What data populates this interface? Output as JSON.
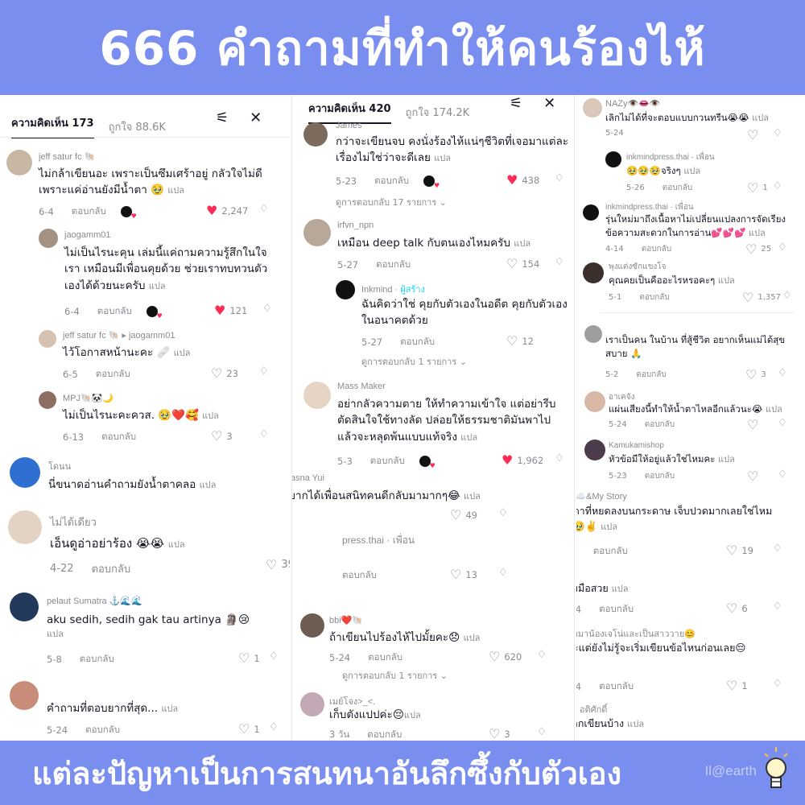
{
  "header": {
    "title": "666 คำถามที่ทำให้คนร้องไห้"
  },
  "footer": {
    "caption": "แต่ละปัญหาเป็นการสนทนาอันลึกซึ้งกับตัวเอง",
    "watermark": "Il@earth"
  },
  "common": {
    "reply": "ตอบกลับ",
    "translate": "แปล"
  },
  "left": {
    "tab_comments": "ความคิดเห็น 173",
    "tab_likes": "ถูกใจ 88.6K",
    "comments": [
      {
        "name": "jeff satur fc 🐚",
        "text": "ไม่กล้าเขียนอะ เพราะเป็นซึมเศร้าอยู่ กลัวใจไม่ดี",
        "text2": "เพราะแค่อ่านยังมีน้ำตา 🥹 ",
        "date": "6-4",
        "likes": "2,247"
      },
      {
        "name": "jaogamm01",
        "text": "ไม่เป็นไรนะคุน เล่มนี้แค่ถามความรู้สึกในใจ",
        "text2": "เรา เหมือนมีเพื่อนคุยด้วย ช่วยเราทบทวนตัว",
        "text3": "เองได้ด้วยนะครับ ",
        "date": "6-4",
        "likes": "121"
      },
      {
        "name": "jeff satur fc 🐚 ▸ jaogamm01",
        "text": "ไว้โอกาสหน้านะคะ 🩹 ",
        "date": "6-5",
        "likes": "23"
      },
      {
        "name": "MPJ🐚🐼🌙",
        "text": "ไม่เป็นไรนะคะควส. 🥹❤️🥰 ",
        "date": "6-13",
        "likes": "3"
      },
      {
        "name": "โดนน",
        "text": "นี่ขนาดอ่านคำถามยังน้ำตาคลอ "
      },
      {
        "name": "ไม่ได้เดียว",
        "text": "เอ็นดูอ่าอย่าร้อง 😭😭 ",
        "date": "4-22",
        "likes": "39"
      },
      {
        "name": "pelaut Sumatra ⚓🌊🌊",
        "text": "aku sedih, sedih gak tau artinya 🗿😢",
        "date": "5-8",
        "likes": "1"
      },
      {
        "name": "",
        "text": "คำถามที่ตอบยากที่สุด... ",
        "date": "5-24",
        "likes": "1"
      }
    ]
  },
  "mid": {
    "tab_comments": "ความคิดเห็น 420",
    "tab_likes": "ถูกใจ 174.2K",
    "comments": [
      {
        "name": "James",
        "text": "กว่าจะเขียนจบ คงนั่งร้องไห้แน่ๆชีวิตที่เจอมาแต่ละ",
        "text2": "เรื่องไม่ใช่ว่าจะดีเลย ",
        "date": "5-23",
        "likes": "438",
        "more": "ดูการตอบกลับ 17 รายการ ⌄"
      },
      {
        "name": "irfvn_npn",
        "text": "เหมือน deep talk กับตนเองไหมครับ ",
        "date": "5-27",
        "likes": "154"
      },
      {
        "name": "Inkmind",
        "badge": "· ผู้สร้าง",
        "text": "ฉันคิดว่าใช่ คุยกับตัวเองในอดีต คุยกับตัวเอง",
        "text2": "ในอนาคตด้วย",
        "date": "5-27",
        "likes": "12",
        "more": "ดูการตอบกลับ 1 รายการ ⌄"
      },
      {
        "name": "Mass Maker",
        "text": "อย่ากลัวความตาย ให้ทำความเข้าใจ แต่อย่ารีบ",
        "text2": "ตัดสินใจใช้ทางลัด ปล่อยให้ธรรมชาติมันพาไป",
        "text3": "แล้วจะหลุดพ้นแบบแท้จริง ",
        "date": "5-3",
        "likes": "1,962"
      },
      {
        "name": "Wasna Yui",
        "text": "อยากได้เพื่อนสนิทคนดีกลับมามากๆ😂 ",
        "likes": "49"
      },
      {
        "name": "press.thai · เพื่อน",
        "likes": "13"
      },
      {
        "name": "bbi❤️🐚",
        "text": "ถ้าเขียนไปร้องไห้ไปมั้ยคะ😞 ",
        "date": "5-24",
        "likes": "620",
        "more": "ดูการตอบกลับ 1 รายการ ⌄"
      },
      {
        "name": "เมย์โจง>_<.",
        "text": "เก็บตังแปปค่ะ😔",
        "date": "3 วัน",
        "likes": "3"
      }
    ]
  },
  "right": {
    "comments": [
      {
        "name": "NAZy👁️👄👁️",
        "text": "เลิกไม่ได้ที่จะตอบแบบกวนทรีน😭😭 ",
        "date": "5-24"
      },
      {
        "name": "inkmindpress.thai · เพื่อน",
        "text": "🥹🥹🥹จริงๆ ",
        "date": "5-26",
        "likes": "1"
      },
      {
        "name": "inkmindpress.thai · เพื่อน",
        "text": "รุ่นใหม่มาถึงเนื้อหาไม่เปลี่ยนแปลงการจัดเรียง",
        "text2": "ข้อความสะดวกในการอ่าน💕💕💕 ",
        "date": "4-14",
        "likes": "25"
      },
      {
        "name": "พุงแต่งซักแขงโจ",
        "text": "คุณคยเป็นคืออะไรหรอคะๆ ",
        "date": "5-1",
        "likes": "1,357"
      },
      {
        "name": "",
        "text": "เราเป็นคน ในบ้าน ที่สู้ชีวิต อยากเห็นแม่ได้สุข",
        "text2": "สบาย 🙏",
        "date": "5-2",
        "likes": "3"
      },
      {
        "name": "อาเคจัง",
        "text": "แผ่นเสียงนี้ทำให้น้ำตาไหลอีกแล้วนะ😭 ",
        "date": "5-24"
      },
      {
        "name": "Kamukamishop",
        "text": "หัวข้อมีให้อยู่แล้วใช่ไหมคะ ",
        "date": "5-23"
      },
      {
        "name": "Sky☁️&My Story",
        "text": "น้ำตาที่หยดลงบนกระดาษ เจ็บปวดมากเลยใช่ไหม",
        "text2": "คะ🥹✌️ ",
        "date": "6-3",
        "likes": "19"
      },
      {
        "name": "p",
        "text": "ลายมือสวย ",
        "date": "5-24",
        "likes": "6"
      },
      {
        "name": "มัมหมาน้องเจโน่และเป็นสาววาย😊",
        "text": "มีละแต่ยังไม่รู้จะเริ่มเขียนข้อไหนก่อนเลย😔",
        "text2": "แปล",
        "date": "5-24",
        "likes": "1"
      },
      {
        "name": "บอม อติศักดิ์",
        "text": "อยากเขียนบ้าง "
      }
    ]
  },
  "colors": {
    "banner": "#7a8ef0",
    "like_red": "#fe2c55",
    "muted": "#8a8b91"
  }
}
